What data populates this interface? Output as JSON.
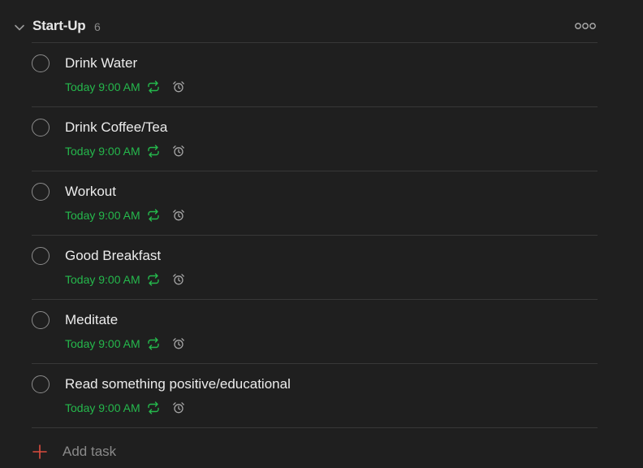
{
  "section": {
    "title": "Start-Up",
    "count": "6"
  },
  "tasks": [
    {
      "title": "Drink Water",
      "due": "Today 9:00 AM"
    },
    {
      "title": "Drink Coffee/Tea",
      "due": "Today 9:00 AM"
    },
    {
      "title": "Workout",
      "due": "Today 9:00 AM"
    },
    {
      "title": "Good Breakfast",
      "due": "Today 9:00 AM"
    },
    {
      "title": "Meditate",
      "due": "Today 9:00 AM"
    },
    {
      "title": "Read something positive/educational",
      "due": "Today 9:00 AM"
    }
  ],
  "add_task": {
    "label": "Add task"
  },
  "icons": {
    "collapse": "chevron-down-icon",
    "more": "more-options-icon",
    "recurring": "recurring-icon",
    "reminder": "alarm-clock-icon",
    "add": "plus-icon"
  },
  "colors": {
    "background": "#1f1f1f",
    "due_date": "#25b84c",
    "add_plus": "#dc4c3e",
    "divider": "#383838"
  }
}
